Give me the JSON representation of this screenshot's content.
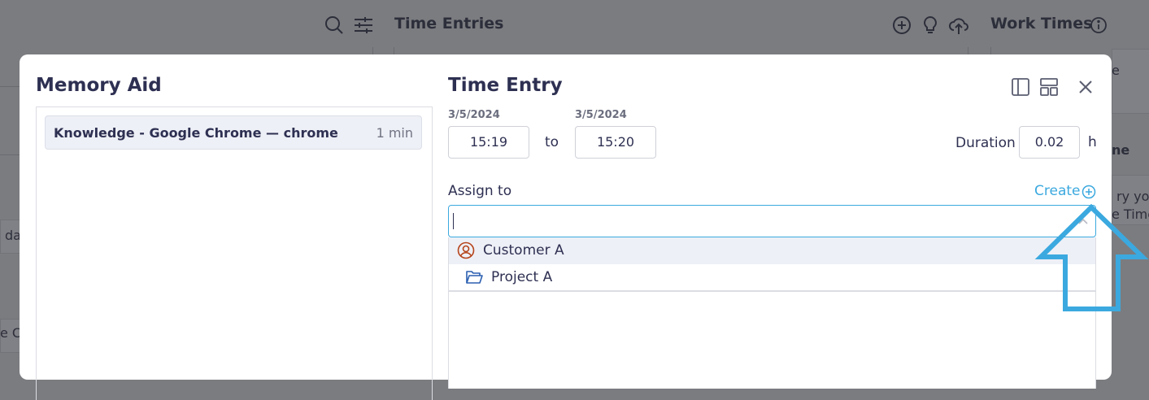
{
  "background": {
    "time_entries_title": "Time Entries",
    "work_times_title": "Work Times",
    "fragments": [
      "e",
      "ne",
      "ry you",
      "e Time",
      "da",
      "e C"
    ]
  },
  "modal": {
    "memory_aid": {
      "title": "Memory Aid",
      "items": [
        {
          "label": "Knowledge - Google Chrome — chrome",
          "duration": "1 min"
        }
      ]
    },
    "time_entry": {
      "title": "Time Entry",
      "start_date": "3/5/2024",
      "end_date": "3/5/2024",
      "start_time": "15:19",
      "end_time": "15:20",
      "to_label": "to",
      "duration_label": "Duration",
      "duration_value": "0.02",
      "duration_unit": "h",
      "assign_label": "Assign to",
      "create_label": "Create",
      "assign_value": "",
      "options": [
        {
          "label": "Customer A",
          "icon": "customer-icon"
        },
        {
          "label": "Project A",
          "icon": "folder-open-icon"
        }
      ]
    }
  },
  "colors": {
    "accent": "#3ba9df",
    "title": "#2e3052",
    "customer_icon": "#b5441a",
    "project_icon": "#2b5fb0",
    "overlay_arrow": "#3ba9df"
  }
}
